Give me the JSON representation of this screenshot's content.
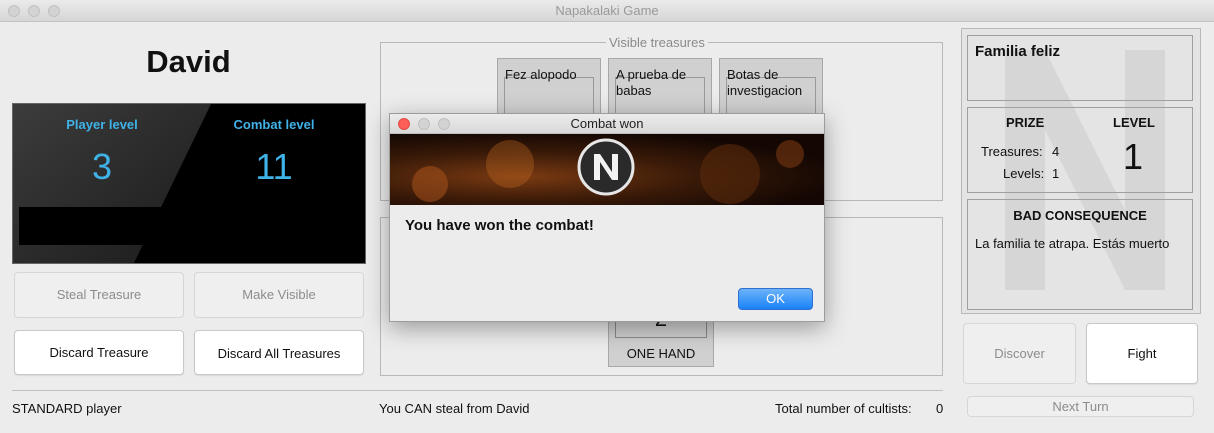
{
  "window": {
    "title": "Napakalaki Game"
  },
  "player": {
    "name": "David",
    "player_level_label": "Player level",
    "player_level": "3",
    "combat_level_label": "Combat level",
    "combat_level": "11"
  },
  "actions": {
    "steal_treasure": "Steal Treasure",
    "make_visible": "Make Visible",
    "discard_treasure": "Discard Treasure",
    "discard_all": "Discard All Treasures"
  },
  "visible_treasures": {
    "legend": "Visible treasures",
    "cards": [
      {
        "name": "Fez alopodo"
      },
      {
        "name": "A prueba de babas"
      },
      {
        "name": "Botas de investigacion"
      }
    ]
  },
  "hidden_card": {
    "bonus": "2",
    "type": "ONE HAND"
  },
  "status_bar": {
    "player_type": "STANDARD player",
    "steal_status": "You CAN steal from David",
    "cultists_label": "Total number of cultists:",
    "cultists_count": "0"
  },
  "monster": {
    "name": "Familia feliz",
    "prize_label": "PRIZE",
    "level_label": "LEVEL",
    "treasures_label": "Treasures:",
    "treasures_value": "4",
    "levels_label": "Levels:",
    "levels_value": "1",
    "level_value": "1",
    "bad_consequence_label": "BAD CONSEQUENCE",
    "bad_consequence_text": "La familia te atrapa. Estás muerto"
  },
  "game_buttons": {
    "discover": "Discover",
    "fight": "Fight",
    "next_turn": "Next Turn"
  },
  "dialog": {
    "title": "Combat won",
    "message": "You have won the combat!",
    "ok_label": "OK"
  },
  "colors": {
    "accent_blue": "#3fb2e8",
    "ok_button": "#1a82f7"
  }
}
